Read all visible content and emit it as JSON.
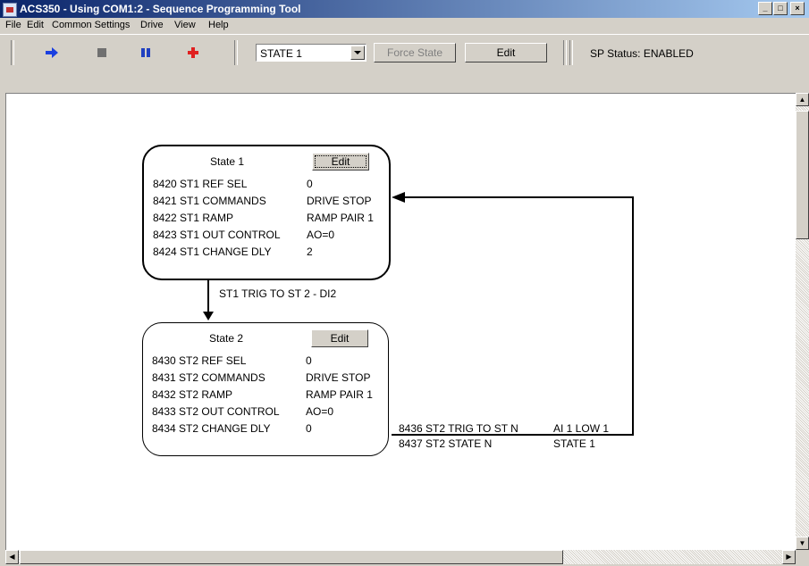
{
  "window": {
    "title": "ACS350 - Using COM1:2 - Sequence Programming Tool",
    "controls": {
      "minimize": "_",
      "maximize": "□",
      "close": "×"
    }
  },
  "menu": [
    "File",
    "Edit",
    "Common Settings",
    "Drive",
    "View",
    "Help"
  ],
  "toolbar": {
    "icons": [
      "run-arrow-icon",
      "stop-icon",
      "pause-icon",
      "reset-cross-icon"
    ],
    "state_select": "STATE 1",
    "force_state_label": "Force State",
    "edit_label": "Edit",
    "sp_status": "SP Status: ENABLED"
  },
  "states": [
    {
      "title": "State 1",
      "edit_label": "Edit",
      "params": [
        {
          "name": "8420 ST1 REF SEL",
          "value": "0"
        },
        {
          "name": "8421 ST1 COMMANDS",
          "value": "DRIVE STOP"
        },
        {
          "name": "8422 ST1 RAMP",
          "value": "RAMP PAIR 1"
        },
        {
          "name": "8423 ST1 OUT CONTROL",
          "value": "AO=0"
        },
        {
          "name": "8424 ST1 CHANGE DLY",
          "value": "2"
        }
      ]
    },
    {
      "title": "State 2",
      "edit_label": "Edit",
      "params": [
        {
          "name": "8430 ST2 REF SEL",
          "value": "0"
        },
        {
          "name": "8431 ST2 COMMANDS",
          "value": "DRIVE STOP"
        },
        {
          "name": "8432 ST2 RAMP",
          "value": "RAMP PAIR 1"
        },
        {
          "name": "8433 ST2 OUT CONTROL",
          "value": "AO=0"
        },
        {
          "name": "8434 ST2 CHANGE DLY",
          "value": "0"
        }
      ]
    }
  ],
  "transitions": {
    "t1_label": "ST1 TRIG TO ST 2 - DI2",
    "t2": [
      {
        "name": "8436 ST2 TRIG TO ST N",
        "value": "AI 1 LOW 1"
      },
      {
        "name": "8437 ST2 STATE N",
        "value": "STATE 1"
      }
    ]
  },
  "colors": {
    "title_gradient_start": "#0a246a",
    "title_gradient_end": "#a6caf0",
    "run_arrow": "#1a3fe0",
    "reset_cross": "#e02020",
    "pause": "#2040c0",
    "stop": "#707070"
  }
}
